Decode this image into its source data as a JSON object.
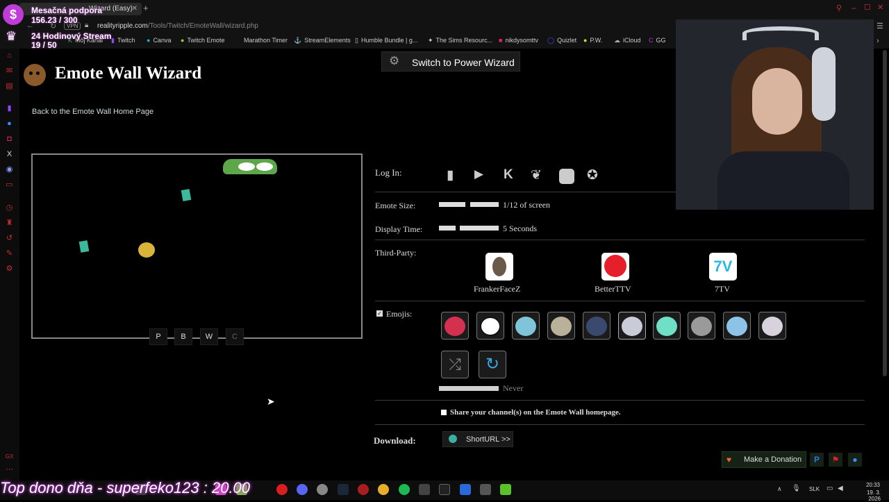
{
  "overlay": {
    "support_title": "Mesačná podpora",
    "support_value": "156.23 / 300",
    "stream_title": "24 Hodinový Stream",
    "stream_value": "19 / 50",
    "top_donor": "Top dono dňa - superfeko123 : 20.00"
  },
  "browser": {
    "tab_title": "Wizard (Easy)",
    "vpn_label": "VPN",
    "url_domain": "realityripple.com",
    "url_path": "/Tools/Twitch/EmoteWall/wizard.php",
    "bookmarks": [
      "Môj Kanál",
      "Twitch",
      "Canva",
      "Twitch Emote",
      "Marathon Timer",
      "StreamElements",
      "Humble Bundle | g...",
      "The Sims Resourc...",
      "nikdysomttv",
      "Quizlet",
      "P.W.",
      "iCloud",
      "GG"
    ]
  },
  "page": {
    "title": "Emote Wall Wizard",
    "power_wizard_label": "Switch to Power Wizard",
    "back_link": "Back to the Emote Wall Home Page",
    "preview_buttons": [
      "P",
      "B",
      "W",
      "C"
    ],
    "login_label": "Log In:",
    "emote_size_label": "Emote Size:",
    "emote_size_value": "1/12 of screen",
    "display_time_label": "Display Time:",
    "display_time_value": "5 Seconds",
    "third_party_label": "Third-Party:",
    "third_party": [
      {
        "name": "FrankerFaceZ",
        "color": "#6b5a4a"
      },
      {
        "name": "BetterTTV",
        "color": "#e5202a"
      },
      {
        "name": "7TV",
        "color": "#29b6e8"
      }
    ],
    "emojis_label": "Emojis:",
    "emojis_checked": true,
    "emoji_bowls": [
      "#d4304f",
      "#2a2a2a",
      "#7fc4d8",
      "#b9b19a",
      "#3a4a6e",
      "#c9ccd6",
      "#6fe0c5",
      "#9a9a9a",
      "#8ec3e8",
      "#d8d2dc"
    ],
    "shuffle_label": "Never",
    "share_label": "Share your channel(s) on the Emote Wall homepage.",
    "download_label": "Download:",
    "shorturl_label": "ShortURL >>",
    "donate_label": "Make a Donation"
  },
  "taskbar": {
    "lang": "SLK",
    "time": "20:33",
    "date": "19. 3. 2026"
  }
}
